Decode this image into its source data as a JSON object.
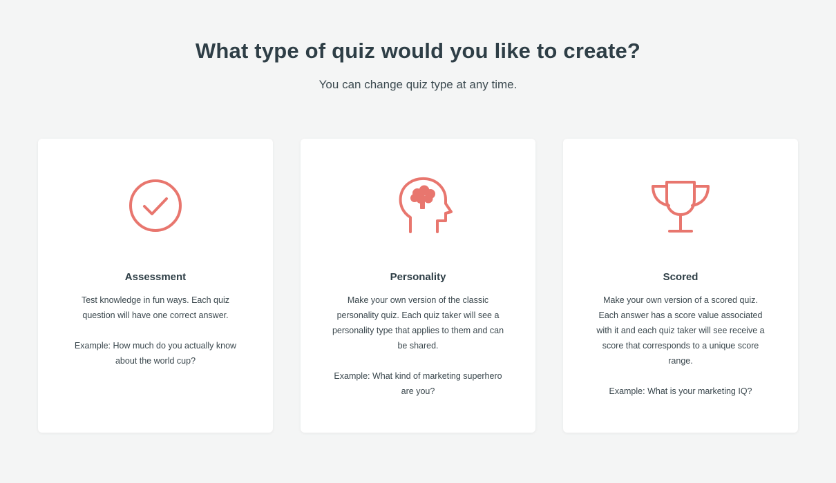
{
  "header": {
    "title": "What type of quiz would you like to create?",
    "subtitle": "You can change quiz type at any time."
  },
  "colors": {
    "accent": "#e8766e",
    "background": "#f4f5f5",
    "card": "#ffffff",
    "heading": "#2e3e46"
  },
  "cards": [
    {
      "icon": "checkmark-circle-icon",
      "title": "Assessment",
      "description": "Test knowledge in fun ways. Each quiz question will have one correct answer.",
      "example": "Example: How much do you actually know about the world cup?"
    },
    {
      "icon": "head-brain-icon",
      "title": "Personality",
      "description": "Make your own version of the classic personality quiz. Each quiz taker will see a personality type that applies to them and can be shared.",
      "example": "Example: What kind of marketing superhero are you?"
    },
    {
      "icon": "trophy-icon",
      "title": "Scored",
      "description": "Make your own version of a scored quiz. Each answer has a score value associated with it and each quiz taker will see receive a score that corresponds to a unique score range.",
      "example": "Example: What is your marketing IQ?"
    }
  ]
}
